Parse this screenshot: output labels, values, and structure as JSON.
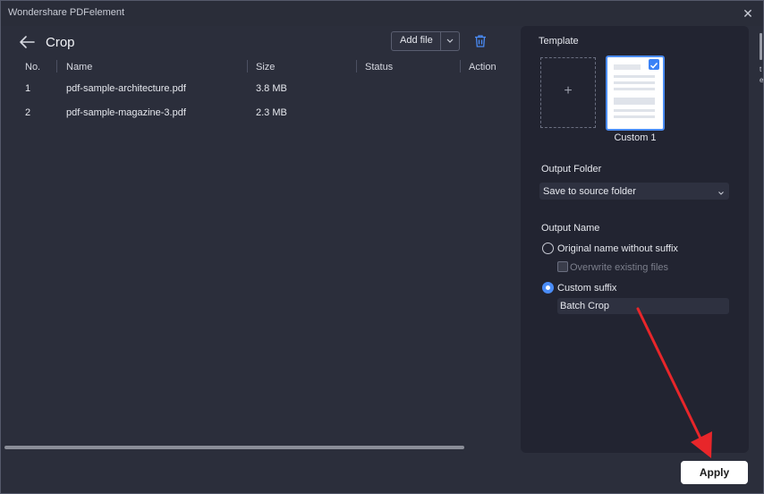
{
  "window": {
    "app_title": "Wondershare PDFelement",
    "close_glyph": "✕"
  },
  "left": {
    "page_title": "Crop",
    "add_file_label": "Add file",
    "columns": [
      "No.",
      "Name",
      "Size",
      "Status",
      "Action"
    ],
    "rows": [
      {
        "no": "1",
        "name": "pdf-sample-architecture.pdf",
        "size": "3.8 MB",
        "status": "",
        "action": ""
      },
      {
        "no": "2",
        "name": "pdf-sample-magazine-3.pdf",
        "size": "2.3 MB",
        "status": "",
        "action": ""
      }
    ]
  },
  "panel": {
    "template_label": "Template",
    "add_template_glyph": "+",
    "template_name": "Custom 1",
    "output_folder_label": "Output Folder",
    "output_folder_value": "Save to source folder",
    "output_name_label": "Output Name",
    "option_original": "Original name without suffix",
    "overwrite_label": "Overwrite existing files",
    "option_custom": "Custom suffix",
    "suffix_value": "Batch Crop",
    "selected_option": "custom"
  },
  "footer": {
    "apply_label": "Apply"
  },
  "edge_fragments": [
    "t",
    "e"
  ],
  "colors": {
    "accent": "#4a8cf7",
    "annotation_arrow": "#e8262a",
    "panel_bg": "#222431",
    "window_bg": "#2b2e3b"
  },
  "icons": {
    "back": "arrow-left-icon",
    "trash": "trash-icon",
    "dropdown": "chevron-down-icon",
    "check": "checkmark-icon"
  }
}
